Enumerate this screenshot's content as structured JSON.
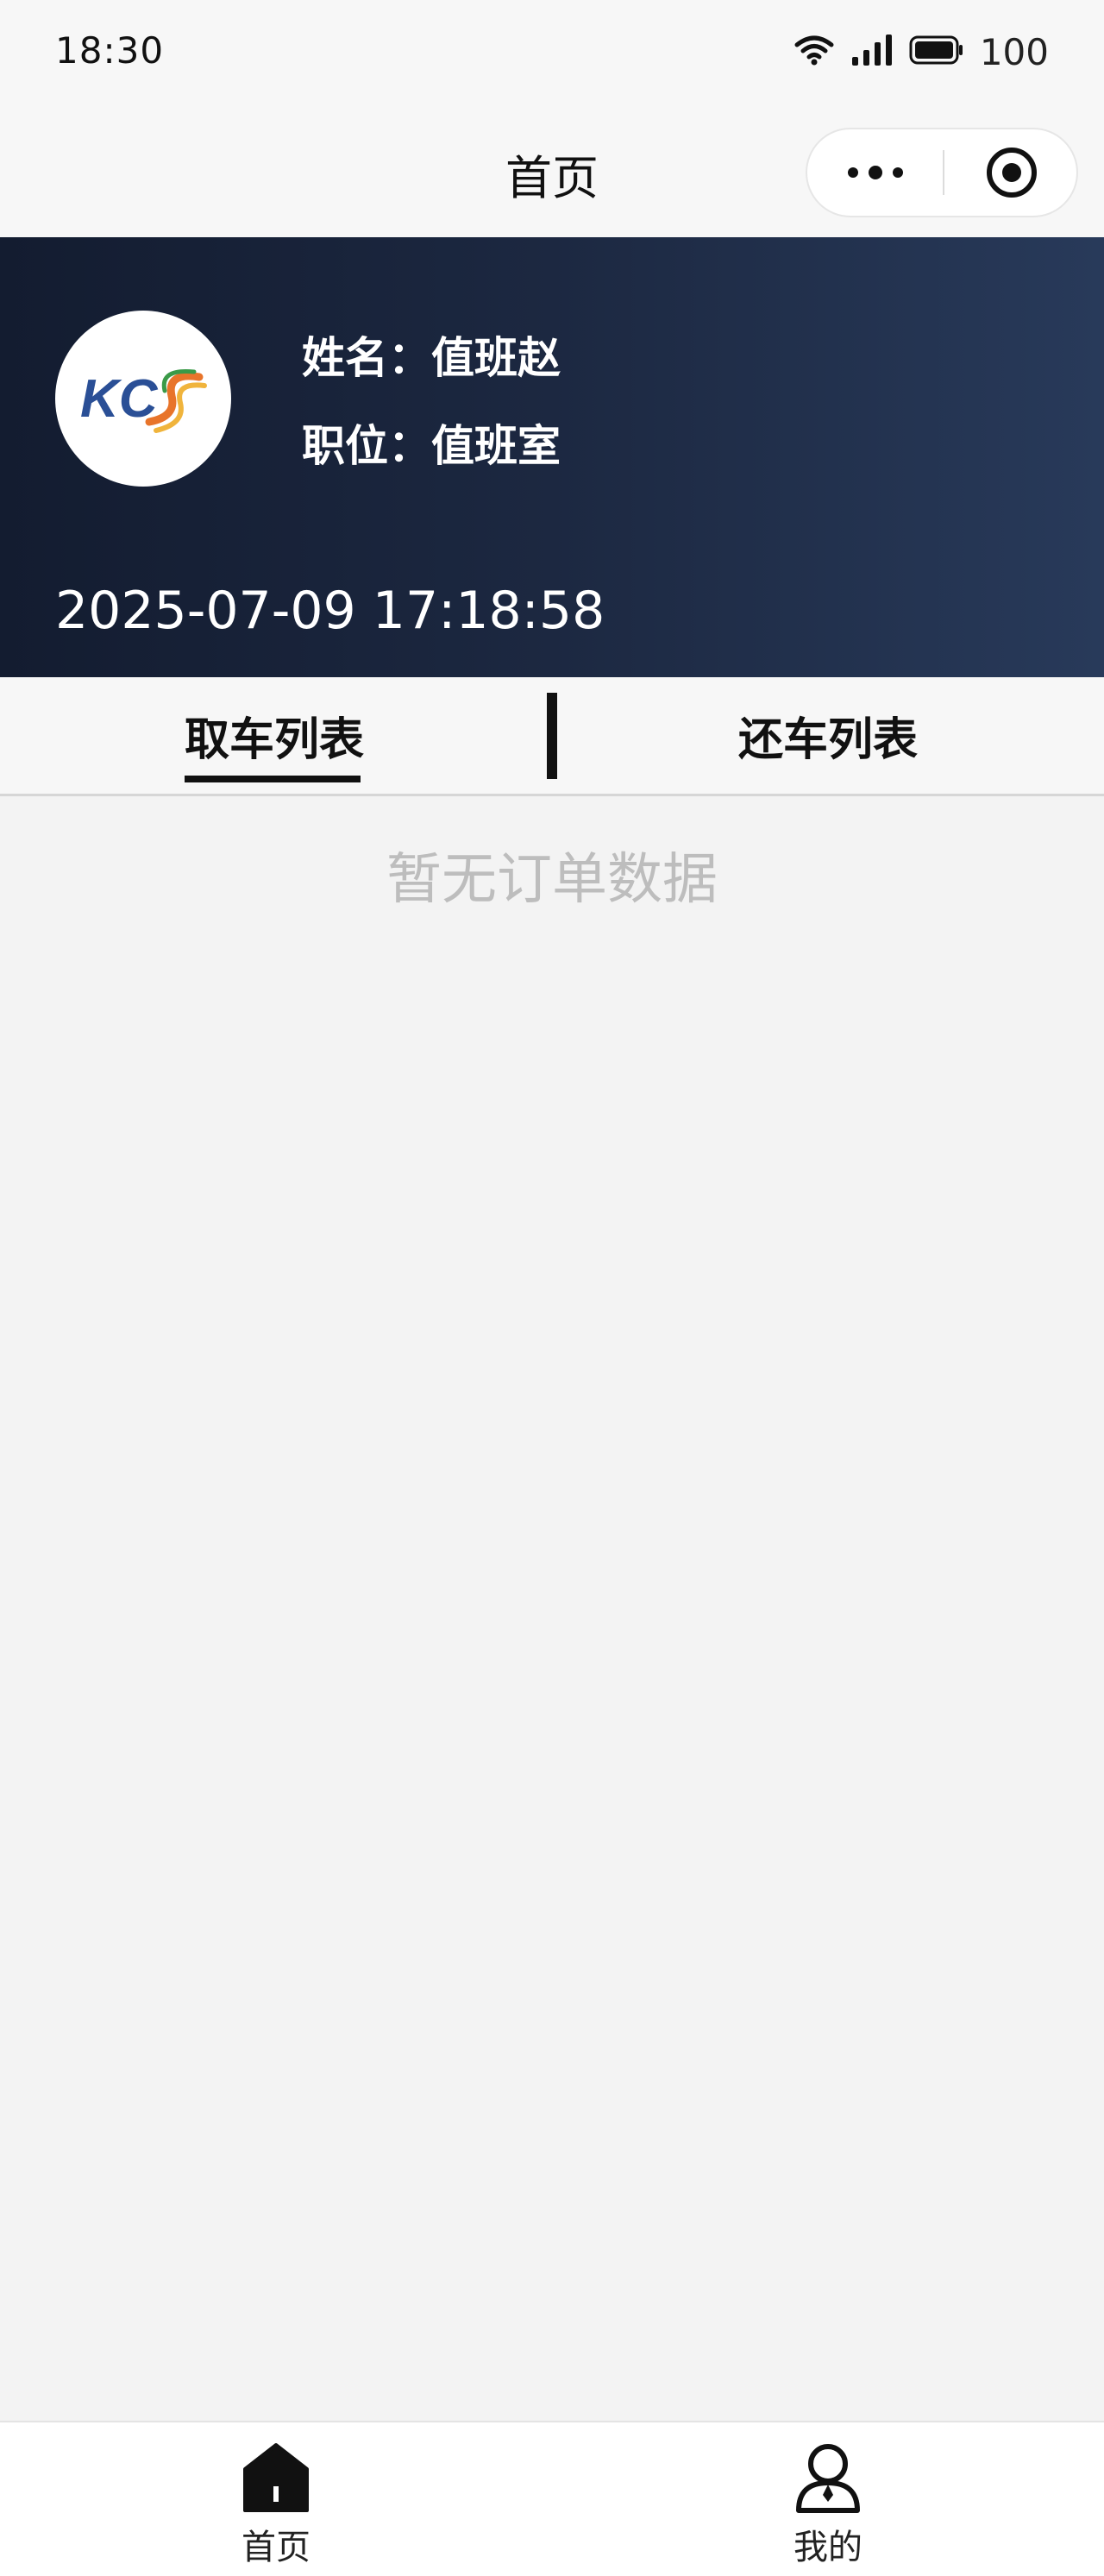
{
  "status_bar": {
    "time": "18:30",
    "battery_level": "100",
    "icons": [
      "wifi-icon",
      "signal-icon",
      "battery-icon"
    ]
  },
  "nav": {
    "title": "首页",
    "more_icon": "more-dots-icon",
    "close_icon": "target-close-icon"
  },
  "profile": {
    "logo_text": "KCS",
    "name_line": "姓名：值班赵",
    "position_line": "职位：值班室",
    "datetime": "2025-07-09 17:18:58",
    "banner_colors": [
      "#131c30",
      "#283a5a"
    ]
  },
  "tabs": {
    "items": [
      {
        "label": "取车列表",
        "active": true
      },
      {
        "label": "还车列表",
        "active": false
      }
    ]
  },
  "list": {
    "empty_text": "暂无订单数据"
  },
  "bottom_tabs": {
    "items": [
      {
        "label": "首页",
        "icon": "home-icon",
        "active": true
      },
      {
        "label": "我的",
        "icon": "user-icon",
        "active": false
      }
    ]
  }
}
